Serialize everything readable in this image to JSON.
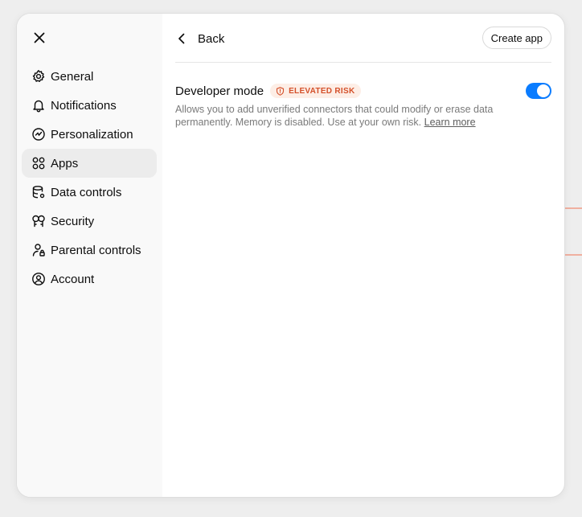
{
  "sidebar": {
    "close_icon": "close-icon",
    "items": [
      {
        "label": "General",
        "icon": "gear-icon",
        "active": false
      },
      {
        "label": "Notifications",
        "icon": "bell-icon",
        "active": false
      },
      {
        "label": "Personalization",
        "icon": "personalization-icon",
        "active": false
      },
      {
        "label": "Apps",
        "icon": "apps-grid-icon",
        "active": true
      },
      {
        "label": "Data controls",
        "icon": "database-icon",
        "active": false
      },
      {
        "label": "Security",
        "icon": "key-icon",
        "active": false
      },
      {
        "label": "Parental controls",
        "icon": "parental-icon",
        "active": false
      },
      {
        "label": "Account",
        "icon": "user-circle-icon",
        "active": false
      }
    ]
  },
  "header": {
    "back_label": "Back",
    "create_label": "Create app"
  },
  "developer_mode": {
    "title": "Developer mode",
    "badge": "ELEVATED RISK",
    "description": "Allows you to add unverified connectors that could modify or erase data permanently. Memory is disabled. Use at your own risk.",
    "link": "Learn more",
    "enabled": true
  },
  "colors": {
    "accent": "#0a7cff",
    "risk": "#d4502a",
    "risk_bg": "#fdeee6",
    "active_item_bg": "#ececec"
  }
}
